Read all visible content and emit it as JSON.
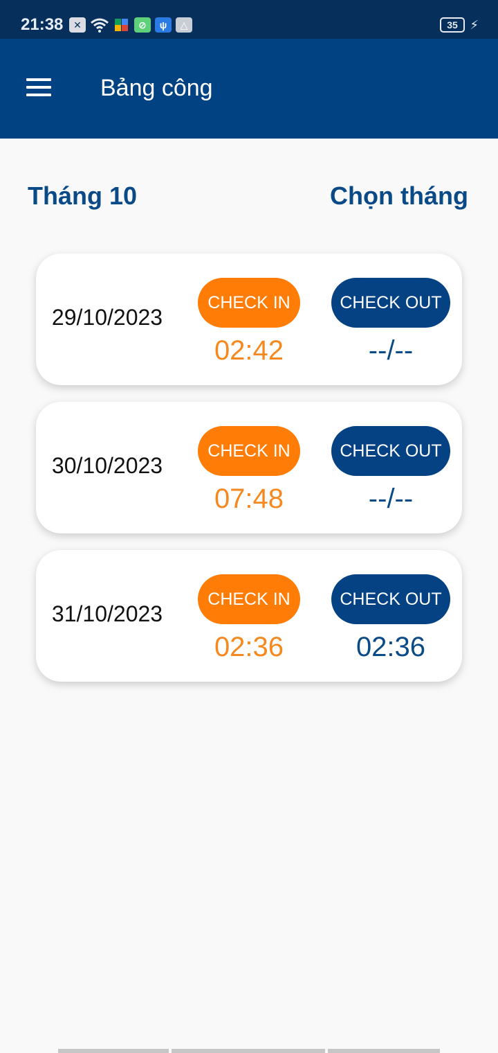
{
  "status_bar": {
    "time": "21:38",
    "battery": "35",
    "icons": [
      "notification-x-icon",
      "wifi-icon",
      "puzzle-icon",
      "app-icon",
      "usb-icon",
      "share-icon",
      "charging-icon"
    ]
  },
  "app_bar": {
    "title": "Bảng công"
  },
  "header": {
    "month_label": "Tháng 10",
    "pick_month_label": "Chọn tháng"
  },
  "records": [
    {
      "date": "29/10/2023",
      "check_in_label": "CHECK IN",
      "check_out_label": "CHECK OUT",
      "check_in_time": "02:42",
      "check_out_time": "--/--"
    },
    {
      "date": "30/10/2023",
      "check_in_label": "CHECK IN",
      "check_out_label": "CHECK OUT",
      "check_in_time": "07:48",
      "check_out_time": "--/--"
    },
    {
      "date": "31/10/2023",
      "check_in_label": "CHECK IN",
      "check_out_label": "CHECK OUT",
      "check_in_time": "02:36",
      "check_out_time": "02:36"
    }
  ],
  "colors": {
    "app_bar": "#004282",
    "status_bar": "#062f5b",
    "check_in": "#ff7c06",
    "check_out": "#044284",
    "accent_text": "#0a4a86"
  }
}
